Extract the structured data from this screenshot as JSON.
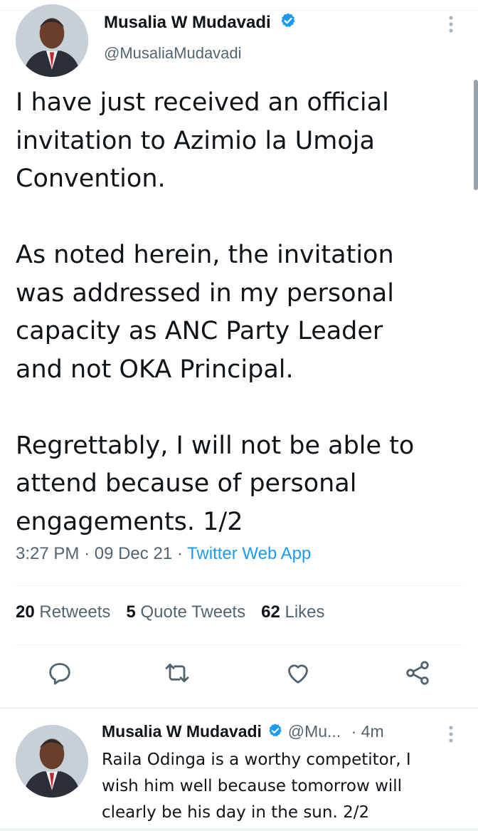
{
  "tweet": {
    "author_name": "Musalia W Mudavadi",
    "author_handle": "@MusaliaMudavadi",
    "text": "I have just received an official\ninvitation to Azimio la Umoja\nConvention.\n\nAs noted herein, the invitation\nwas addressed in my personal\ncapacity as ANC Party Leader\nand not OKA Principal.\n\nRegrettably, I will not be able to\nattend because of personal\nengagements. 1/2",
    "time": "3:27 PM",
    "date": "09 Dec 21",
    "separator": "·",
    "source": "Twitter Web App",
    "stats": {
      "retweets_count": "20",
      "retweets_label": "Retweets",
      "quotes_count": "5",
      "quotes_label": "Quote Tweets",
      "likes_count": "62",
      "likes_label": "Likes"
    }
  },
  "reply": {
    "author_name": "Musalia W Mudavadi",
    "author_handle": "@Mu...",
    "separator": "·",
    "time": "4m",
    "text": "Raila Odinga is a worthy competitor, I\nwish him well because tomorrow will\nclearly be his day in the sun. 2/2"
  },
  "icons": {
    "verified": "verified-badge-icon",
    "more": "more-vertical-icon",
    "reply": "reply-icon",
    "retweet": "retweet-icon",
    "like": "heart-icon",
    "share": "share-icon"
  },
  "colors": {
    "accent": "#1d9bf0",
    "text_primary": "#0f1419",
    "text_secondary": "#536471",
    "divider": "#eff3f4"
  }
}
